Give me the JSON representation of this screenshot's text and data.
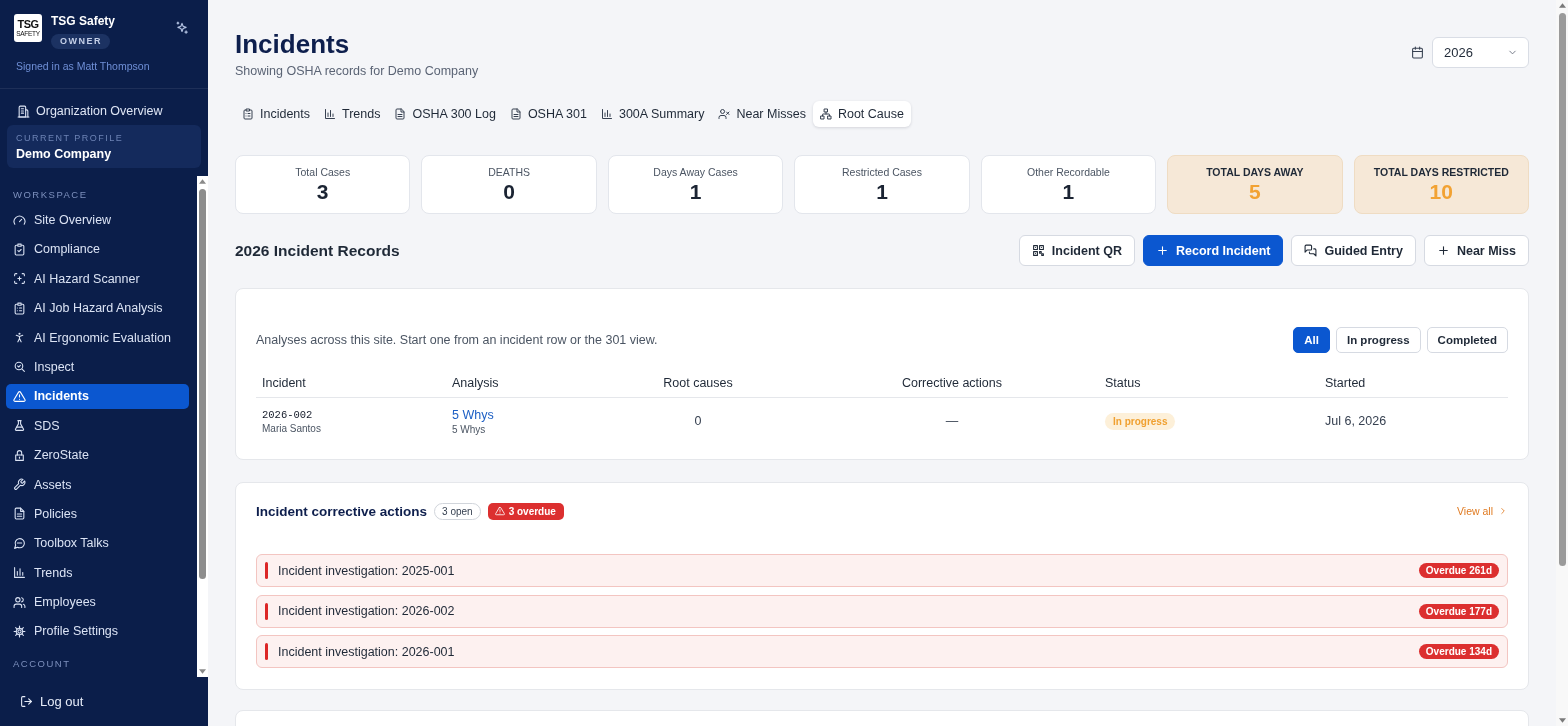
{
  "sidebar": {
    "logo": {
      "line_1": "TSG",
      "line_2": "SAFETY"
    },
    "brand": "TSG Safety",
    "role": "OWNER",
    "signed_in": "Signed in as Matt Thompson",
    "org_link": "Organization Overview",
    "profile": {
      "label": "CURRENT PROFILE",
      "name": "Demo Company"
    },
    "section": "WORKSPACE",
    "items": [
      {
        "label": "Site Overview",
        "selected": false
      },
      {
        "label": "Compliance",
        "selected": false
      },
      {
        "label": "AI Hazard Scanner",
        "selected": false
      },
      {
        "label": "AI Job Hazard Analysis",
        "selected": false
      },
      {
        "label": "AI Ergonomic Evaluation",
        "selected": false
      },
      {
        "label": "Inspect",
        "selected": false
      },
      {
        "label": "Incidents",
        "selected": true
      },
      {
        "label": "SDS",
        "selected": false
      },
      {
        "label": "ZeroState",
        "selected": false
      },
      {
        "label": "Assets",
        "selected": false
      },
      {
        "label": "Policies",
        "selected": false
      },
      {
        "label": "Toolbox Talks",
        "selected": false
      },
      {
        "label": "Trends",
        "selected": false
      },
      {
        "label": "Employees",
        "selected": false
      },
      {
        "label": "Profile Settings",
        "selected": false
      }
    ],
    "account_section": "ACCOUNT",
    "logout": "Log out"
  },
  "header": {
    "title": "Incidents",
    "subtitle": "Showing OSHA records for Demo Company",
    "year": "2026"
  },
  "tabs": [
    {
      "label": "Incidents",
      "selected": false
    },
    {
      "label": "Trends",
      "selected": false
    },
    {
      "label": "OSHA 300 Log",
      "selected": false
    },
    {
      "label": "OSHA 301",
      "selected": false
    },
    {
      "label": "300A Summary",
      "selected": false
    },
    {
      "label": "Near Misses",
      "selected": false
    },
    {
      "label": "Root Cause",
      "selected": true
    }
  ],
  "stats": [
    {
      "label": "Total Cases",
      "value": "3",
      "highlighted": false
    },
    {
      "label": "DEATHS",
      "value": "0",
      "highlighted": false
    },
    {
      "label": "Days Away Cases",
      "value": "1",
      "highlighted": false
    },
    {
      "label": "Restricted Cases",
      "value": "1",
      "highlighted": false
    },
    {
      "label": "Other Recordable",
      "value": "1",
      "highlighted": false
    },
    {
      "label": "TOTAL DAYS AWAY",
      "value": "5",
      "highlighted": true
    },
    {
      "label": "TOTAL DAYS RESTRICTED",
      "value": "10",
      "highlighted": true
    }
  ],
  "records": {
    "title": "2026 Incident Records",
    "buttons": [
      {
        "label": "Incident QR",
        "kind": "outline"
      },
      {
        "label": "Record Incident",
        "kind": "primary"
      },
      {
        "label": "Guided Entry",
        "kind": "outline"
      },
      {
        "label": "Near Miss",
        "kind": "outline"
      }
    ]
  },
  "root_cause": {
    "description": "Analyses across this site. Start one from an incident row or the 301 view.",
    "filters": [
      {
        "label": "All",
        "selected": true
      },
      {
        "label": "In progress",
        "selected": false
      },
      {
        "label": "Completed",
        "selected": false
      }
    ],
    "columns": [
      "Incident",
      "Analysis",
      "Root causes",
      "Corrective actions",
      "Status",
      "Started"
    ],
    "rows": [
      {
        "incident": "2026-002",
        "person": "Maria Santos",
        "analysis": "5 Whys",
        "method": "5 Whys",
        "root_causes": "0",
        "corrective_actions": "—",
        "status": "In progress",
        "started": "Jul 6, 2026"
      }
    ]
  },
  "corrective_actions": {
    "title": "Incident corrective actions",
    "open_badge": "3 open",
    "overdue_badge": "3 overdue",
    "view_all": "View all",
    "items": [
      {
        "label": "Incident investigation: 2025-001",
        "due": "Overdue 261d"
      },
      {
        "label": "Incident investigation: 2026-002",
        "due": "Overdue 177d"
      },
      {
        "label": "Incident investigation: 2026-001",
        "due": "Overdue 134d"
      }
    ]
  }
}
